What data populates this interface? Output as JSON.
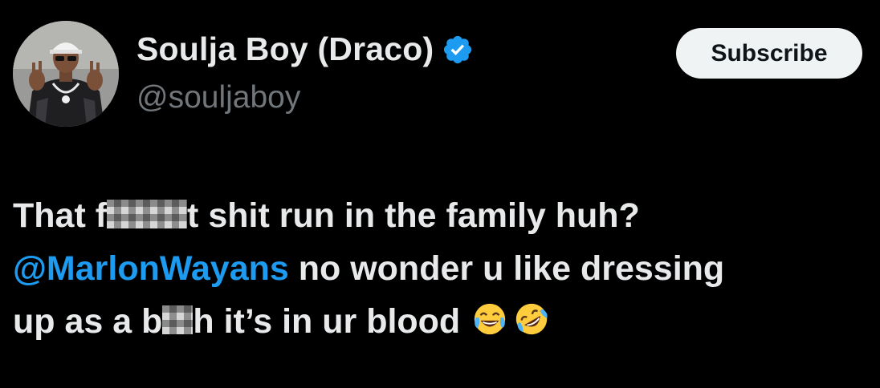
{
  "author": {
    "display_name": "Soulja Boy (Draco)",
    "handle": "@souljaboy",
    "verified": true,
    "verified_color": "#1d9bf0",
    "avatar_icon": "profile-photo"
  },
  "subscribe_button": {
    "label": "Subscribe"
  },
  "tweet": {
    "line1_start": "That f",
    "line1_censor_end": "t shit run in the family huh?",
    "mention": "@MarlonWayans",
    "line2_rest": " no wonder u like dressing",
    "line3_start": "up as a b",
    "line3_end": "h it’s in ur blood",
    "emojis": [
      "face-with-tears-of-joy-icon",
      "rolling-on-floor-laughing-icon"
    ]
  },
  "colors": {
    "background": "#000000",
    "text": "#e7e9ea",
    "secondary_text": "#71767b",
    "link": "#1d9bf0",
    "button_bg": "#eff3f4"
  }
}
